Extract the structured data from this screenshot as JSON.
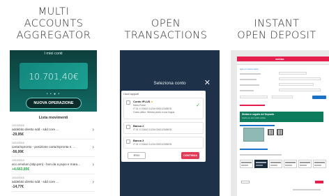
{
  "titles": {
    "col1_line1": "MULTI",
    "col1_line2": "ACCOUNTS",
    "col1_line3": "AGGREGATOR",
    "col2_line1": "OPEN",
    "col2_line2": "TRANSACTIONS",
    "col3_line1": "INSTANT",
    "col3_line2": "OPEN DEPOSIT"
  },
  "aggregator": {
    "header": "I miei conti",
    "balance": "10.701,40€",
    "dots": "• • ● •",
    "new_operation_button": "NUOVA OPERAZIONE",
    "list_title": "Lista movimenti",
    "movements": [
      {
        "date": "10/10/2018",
        "description": "addebito diretto sdd - sdd core ...",
        "amount": "-29,95€",
        "positive": false
      },
      {
        "date": "10/10/2018",
        "description": "carta/mpronto - posizione carta/mpronta n. ...",
        "amount": "-56,00€",
        "positive": false
      },
      {
        "date": "10/10/2018",
        "description": "acc.emolum.(stip.pen) - bon.da          a pupo e mara...",
        "amount": "+4.663,85€",
        "positive": true
      },
      {
        "date": "10/10/2018",
        "description": "addebito diretto sdd - sdd core ...",
        "amount": "-14,77€",
        "positive": false
      }
    ]
  },
  "transactions": {
    "modal_title": "Seleziona conto",
    "close_icon": "close-icon",
    "dialog_header": "I tuoi rapporti",
    "accounts": [
      {
        "name": "Conto IPLUS",
        "line1": "Mario Rossi",
        "line2": "IT 01 X 03442 01234 000012345678",
        "line3": "Conto attivo: Webba punto in tua lingua",
        "selected": true
      },
      {
        "name": "Banca 2",
        "line1": "IT 01 X 03442 01234 000012345678",
        "line2": "",
        "line3": "",
        "selected": false
      },
      {
        "name": "Banca 3",
        "line1": "IT 01 X 03442 01234 000012345678",
        "line2": "",
        "line3": "",
        "selected": false
      }
    ],
    "exit_button": "ESCI",
    "continue_button": "CONTINUA"
  },
  "deposit": {
    "logo": "webba",
    "top_link": "Apri un nuovo conto",
    "banner_title": "Webba in seguito del Deposito",
    "banner_subtitle": "Grazie per aver scelto webba"
  },
  "colors": {
    "teal_dark": "#0d3f3c",
    "teal": "#14877d",
    "navy": "#1d3148",
    "accent_red": "#e23a55",
    "positive_green": "#2aa84a"
  }
}
